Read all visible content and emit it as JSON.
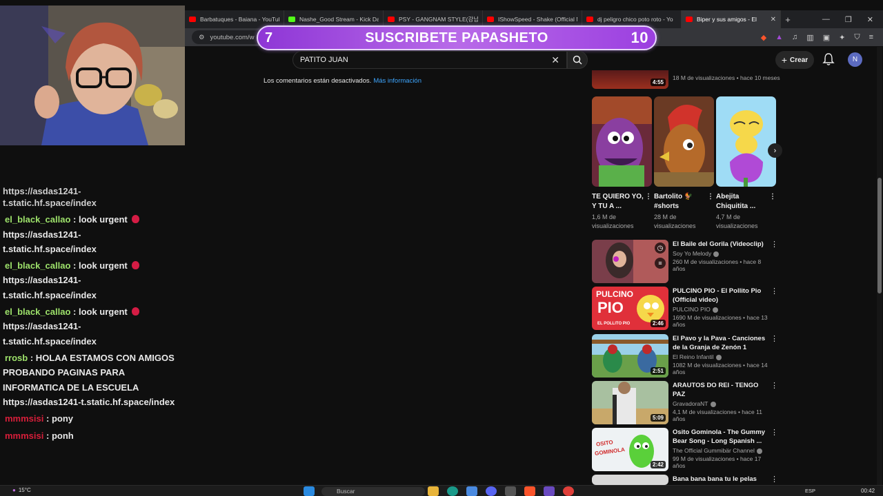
{
  "browser": {
    "tabs": [
      {
        "title": "Barbatuques - Baiana - YouTube",
        "favicon_color": "#ff0000",
        "active": false
      },
      {
        "title": "Nashe_Good Stream - Kick Da",
        "favicon_color": "#53fc18",
        "active": false
      },
      {
        "title": "PSY - GANGNAM STYLE(강남",
        "favicon_color": "#ff0000",
        "active": false
      },
      {
        "title": "IShowSpeed - Shake (Official M",
        "favicon_color": "#ff0000",
        "active": false
      },
      {
        "title": "dj peligro chico poto roto - Yo",
        "favicon_color": "#ff0000",
        "active": false
      },
      {
        "title": "Biper y sus amigos - El",
        "favicon_color": "#ff0000",
        "active": true
      }
    ],
    "new_tab_label": "+",
    "url": "youtube.com/w"
  },
  "overlay": {
    "left_number": "7",
    "banner_text": "SUSCRIBETE PAPASHETO",
    "right_number": "10"
  },
  "youtube": {
    "search_value": "PATITO JUAN",
    "create_label": "Crear",
    "avatar_letter": "N",
    "comments_disabled": "Los comentarios están desactivados.",
    "more_info": "Más información",
    "top_partial": {
      "duration": "4:55",
      "meta": "18 M de visualizaciones • hace 10 meses"
    },
    "shorts": [
      {
        "title": "TE QUIERO YO, Y TU A ...",
        "views": "1,6 M de visualizaciones",
        "bg": "#8a3fa0"
      },
      {
        "title": "Bartolito 🐓 #shorts",
        "views": "28 M de visualizaciones",
        "bg": "#b5462a"
      },
      {
        "title": "Abejita Chiquitita ...",
        "views": "4,7 M de visualizaciones",
        "bg": "#8fd3f0"
      }
    ],
    "recommendations": [
      {
        "title": "El Baile del Gorila (Videoclip)",
        "channel": "Soy Yo Melody",
        "meta": "260 M de visualizaciones • hace 8 años",
        "duration": "",
        "bg": "#7a3e4a"
      },
      {
        "title": "PULCINO PIO - El Pollito Pio (Official video)",
        "channel": "PULCINO PIO",
        "meta": "1690 M de visualizaciones • hace 13 años",
        "duration": "2:46",
        "bg": "#e0303a"
      },
      {
        "title": "El Pavo y la Pava - Canciones de la Granja de Zenón 1",
        "channel": "El Reino Infantil",
        "meta": "1082 M de visualizaciones • hace 14 años",
        "duration": "2:51",
        "bg": "#4f7a3a"
      },
      {
        "title": "ARAUTOS DO REI - TENGO PAZ",
        "channel": "GravadoraNT",
        "meta": "4,1 M de visualizaciones • hace 11 años",
        "duration": "5:09",
        "bg": "#6a8a5a"
      },
      {
        "title": "Osito Gominola - The Gummy Bear Song - Long Spanish ...",
        "channel": "The Official Gummibär Channel",
        "meta": "99 M de visualizaciones • hace 17 años",
        "duration": "2:42",
        "bg": "#e9eef0"
      },
      {
        "title": "Bana bana bana tu le pelas con",
        "channel": "",
        "meta": "",
        "duration": "",
        "bg": "#d8d8d8"
      }
    ]
  },
  "chat": {
    "partial_top": "https://asdas1241-",
    "messages": [
      {
        "user": "",
        "text": "t.static.hf.space/index",
        "user_color": "#e8e8e8",
        "badge": false
      },
      {
        "user": "el_black_callao",
        "text": ": look urgent",
        "user_color": "#9ee36b",
        "badge": true,
        "cont": "https://asdas1241-t.static.hf.space/index"
      },
      {
        "user": "el_black_callao",
        "text": ": look urgent",
        "user_color": "#9ee36b",
        "badge": true,
        "cont": "https://asdas1241-t.static.hf.space/index"
      },
      {
        "user": "el_black_callao",
        "text": ": look urgent",
        "user_color": "#9ee36b",
        "badge": true,
        "cont": "https://asdas1241-t.static.hf.space/index"
      },
      {
        "user": "rrosb",
        "text": ": HOLAA ESTAMOS CON AMIGOS PROBANDO PAGINAS PARA INFORMATICA DE LA ESCUELA https://asdas1241-t.static.hf.space/index",
        "user_color": "#9ee36b",
        "badge": false
      },
      {
        "user": "mmmsisi",
        "text": ": pony",
        "user_color": "#d81e3a",
        "badge": false
      },
      {
        "user": "mmmsisi",
        "text": ": ponh",
        "user_color": "#d81e3a",
        "badge": false
      }
    ]
  },
  "taskbar": {
    "weather": "15°C",
    "search_placeholder": "Buscar",
    "language": "ESP",
    "time": "00:42"
  }
}
